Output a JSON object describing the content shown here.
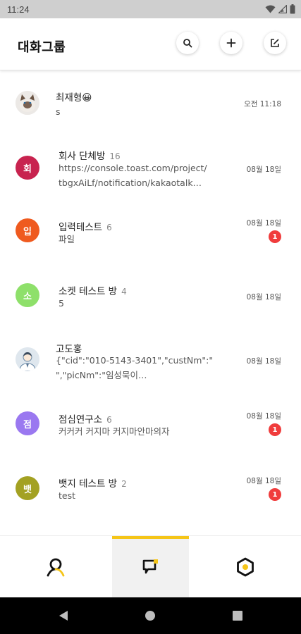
{
  "status_bar": {
    "time": "11:24"
  },
  "header": {
    "title": "대화그룹"
  },
  "colors": {
    "accent": "#f5c518",
    "badge": "#f03c3c"
  },
  "rooms": [
    {
      "title": "최재형😀",
      "count": "",
      "preview": "s",
      "date": "오전 11:18",
      "avatar_text": "",
      "avatar_color": "#e9e9e9",
      "badge": ""
    },
    {
      "title": "회사 단체방",
      "count": "16",
      "preview": "https://console.toast.com/project/",
      "preview2": "tbgxAiLf/notification/kakaotalk…",
      "date": "08월 18일",
      "avatar_text": "회",
      "avatar_color": "#c8234f",
      "badge": ""
    },
    {
      "title": "입력테스트",
      "count": "6",
      "preview": "파일",
      "date": "08월 18일",
      "avatar_text": "입",
      "avatar_color": "#ef5a1f",
      "badge": "1"
    },
    {
      "title": "소켓 테스트 방",
      "count": "4",
      "preview": "5",
      "date": "08월 18일",
      "avatar_text": "소",
      "avatar_color": "#8ee06a",
      "badge": ""
    },
    {
      "title": "고도홍",
      "count": "",
      "preview": "{\"cid\":\"010-5143-3401\",\"custNm\":\"",
      "preview2": "\",\"picNm\":\"임성묵이…",
      "date": "08월 18일",
      "avatar_text": "",
      "avatar_color": "#dfe7ee",
      "badge": ""
    },
    {
      "title": "점심연구소",
      "count": "6",
      "preview": "커커커 커지마 커지마안마의자",
      "date": "08월 18일",
      "avatar_text": "점",
      "avatar_color": "#9a78f0",
      "badge": "1"
    },
    {
      "title": "뱃지 테스트 방",
      "count": "2",
      "preview": "test",
      "date": "08월 18일",
      "avatar_text": "뱃",
      "avatar_color": "#a3a122",
      "badge": "1"
    }
  ]
}
